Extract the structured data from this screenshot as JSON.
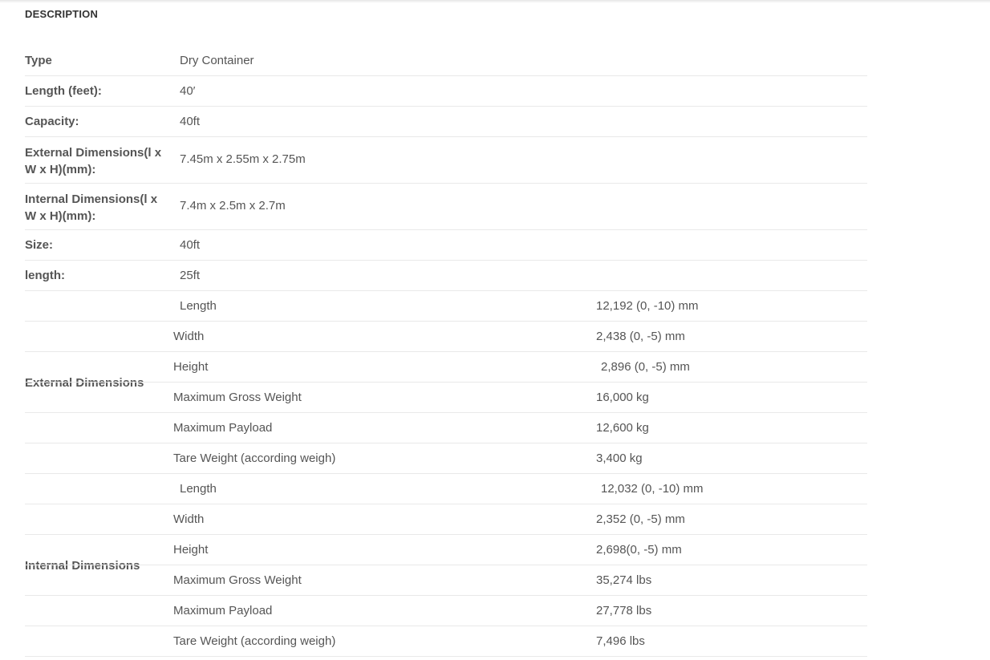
{
  "section_title": "DESCRIPTION",
  "specs": [
    {
      "label": "Type",
      "value": "Dry Container"
    },
    {
      "label": "Length (feet):",
      "value": "40′"
    },
    {
      "label": "Capacity:",
      "value": "40ft"
    },
    {
      "label": "External Dimensions(l x W x H)(mm):",
      "value": "7.45m x 2.55m x 2.75m"
    },
    {
      "label": "Internal Dimensions(l x W x H)(mm):",
      "value": "7.4m x 2.5m x 2.7m"
    },
    {
      "label": "Size:",
      "value": "40ft"
    },
    {
      "label": "length:",
      "value": "25ft"
    }
  ],
  "external": {
    "label": "External Dimensions",
    "rows": [
      {
        "name": "Length",
        "value": "12,192 (0, -10) mm"
      },
      {
        "name": "Width",
        "value": "2,438 (0, -5) mm"
      },
      {
        "name": "Height",
        "value": "2,896 (0, -5) mm"
      },
      {
        "name": "Maximum Gross Weight",
        "value": "16,000 kg"
      },
      {
        "name": "Maximum Payload",
        "value": "12,600 kg"
      },
      {
        "name": "Tare Weight (according weigh)",
        "value": "3,400 kg"
      }
    ]
  },
  "internal": {
    "label": "Internal Dimensions",
    "rows": [
      {
        "name": "Length",
        "value": "12,032 (0, -10) mm"
      },
      {
        "name": "Width",
        "value": "2,352 (0, -5) mm"
      },
      {
        "name": "Height",
        "value": "2,698(0, -5) mm"
      },
      {
        "name": "Maximum Gross Weight",
        "value": "35,274 lbs"
      },
      {
        "name": "Maximum Payload",
        "value": "27,778 lbs"
      },
      {
        "name": "Tare Weight (according weigh)",
        "value": "7,496 lbs"
      }
    ]
  }
}
